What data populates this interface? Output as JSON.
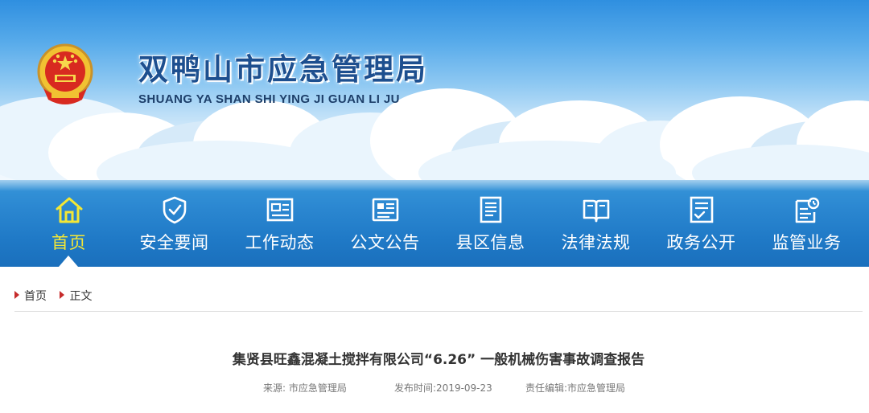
{
  "header": {
    "title": "双鸭山市应急管理局",
    "subtitle": "SHUANG YA SHAN SHI YING JI GUAN LI JU"
  },
  "nav": {
    "active_index": 0,
    "items": [
      {
        "label": "首页",
        "icon": "home-icon"
      },
      {
        "label": "安全要闻",
        "icon": "shield-check-icon"
      },
      {
        "label": "工作动态",
        "icon": "news-icon"
      },
      {
        "label": "公文公告",
        "icon": "notice-icon"
      },
      {
        "label": "县区信息",
        "icon": "document-list-icon"
      },
      {
        "label": "法律法规",
        "icon": "open-book-icon"
      },
      {
        "label": "政务公开",
        "icon": "checklist-icon"
      },
      {
        "label": "监管业务",
        "icon": "supervision-icon"
      }
    ]
  },
  "breadcrumb": {
    "items": [
      "首页",
      "正文"
    ]
  },
  "article": {
    "title": "集贤县旺鑫混凝土搅拌有限公司“6.26” 一般机械伤害事故调查报告",
    "source": "来源: 市应急管理局",
    "publish_time": "发布时间:2019-09-23",
    "editor": "责任编辑:市应急管理局"
  },
  "colors": {
    "title_blue": "#1d4f8f",
    "nav_blue": "#2a86d0",
    "active_yellow": "#f4e735",
    "breadcrumb_arrow": "#c62b2b"
  }
}
